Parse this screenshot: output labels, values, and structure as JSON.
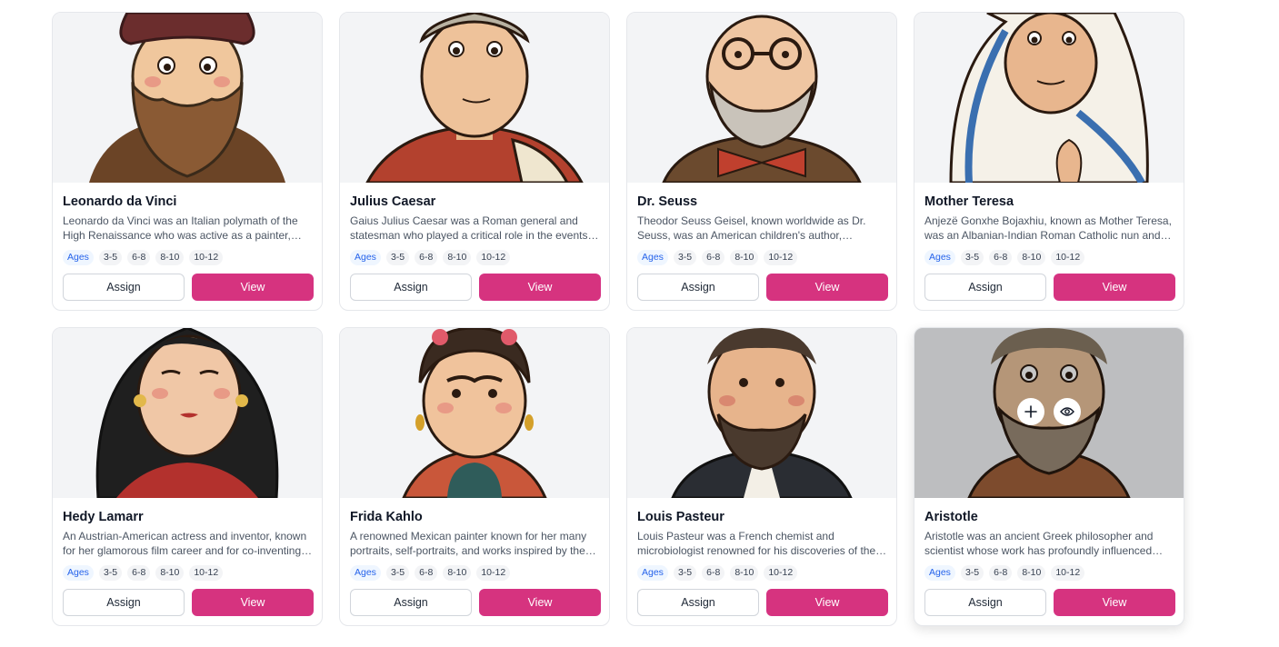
{
  "age_label": "Ages",
  "age_ranges": [
    "3-5",
    "6-8",
    "8-10",
    "10-12"
  ],
  "buttons": {
    "assign": "Assign",
    "view": "View"
  },
  "colors": {
    "accent": "#d6337f",
    "ages_badge_text": "#2563eb",
    "ages_badge_bg": "#eff6ff"
  },
  "cards": [
    {
      "name": "Leonardo da Vinci",
      "description": "Leonardo da Vinci was an Italian polymath of the High Renaissance who was active as a painter, engineer and scientist."
    },
    {
      "name": "Julius Caesar",
      "description": "Gaius Julius Caesar was a Roman general and statesman who played a critical role in the events that led to the demise of the Roman Republic."
    },
    {
      "name": "Dr. Seuss",
      "description": "Theodor Seuss Geisel, known worldwide as Dr. Seuss, was an American children's author, illustrator and animator."
    },
    {
      "name": "Mother Teresa",
      "description": "Anjezë Gonxhe Bojaxhiu, known as Mother Teresa, was an Albanian-Indian Roman Catholic nun and missionary."
    },
    {
      "name": "Hedy Lamarr",
      "description": "An Austrian-American actress and inventor, known for her glamorous film career and for co-inventing frequency hopping."
    },
    {
      "name": "Frida Kahlo",
      "description": "A renowned Mexican painter known for her many portraits, self-portraits, and works inspired by the nature and artifacts of Mexico."
    },
    {
      "name": "Louis Pasteur",
      "description": "Louis Pasteur was a French chemist and microbiologist renowned for his discoveries of the principles of vaccination."
    },
    {
      "name": "Aristotle",
      "description": "Aristotle was an ancient Greek philosopher and scientist whose work has profoundly influenced Western thought."
    }
  ],
  "hover_card": {
    "name": "Aristotle",
    "actions": [
      "plus-icon",
      "eye-icon"
    ]
  }
}
